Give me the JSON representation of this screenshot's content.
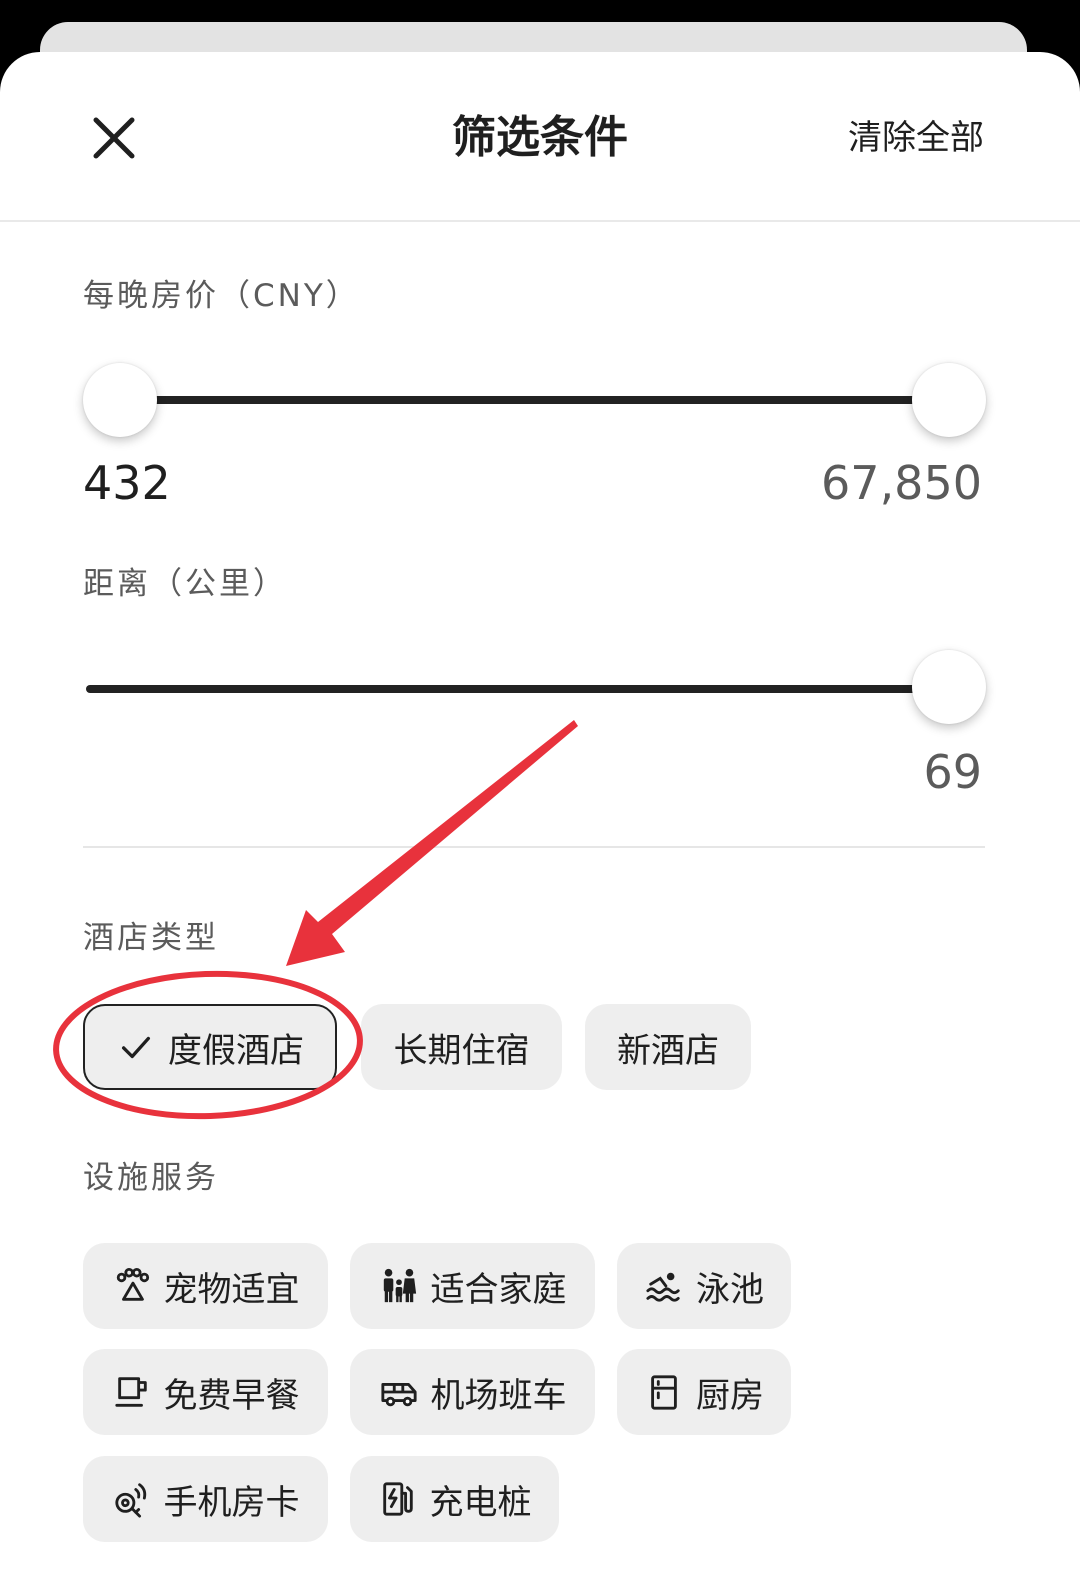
{
  "header": {
    "title": "筛选条件",
    "clear_label": "清除全部"
  },
  "price": {
    "label": "每晚房价（CNY）",
    "min_value": "432",
    "max_value": "67,850",
    "range_low_fraction": 0.0,
    "range_high_fraction": 1.0
  },
  "distance": {
    "label": "距离（公里）",
    "value": "69",
    "fraction": 1.0
  },
  "hotel_type": {
    "label": "酒店类型",
    "options": [
      {
        "label": "度假酒店",
        "selected": true
      },
      {
        "label": "长期住宿",
        "selected": false
      },
      {
        "label": "新酒店",
        "selected": false
      }
    ]
  },
  "amenities": {
    "label": "设施服务",
    "options": [
      {
        "label": "宠物适宜",
        "icon": "paw-icon"
      },
      {
        "label": "适合家庭",
        "icon": "family-icon"
      },
      {
        "label": "泳池",
        "icon": "pool-icon"
      },
      {
        "label": "免费早餐",
        "icon": "coffee-cup-icon"
      },
      {
        "label": "机场班车",
        "icon": "shuttle-bus-icon"
      },
      {
        "label": "厨房",
        "icon": "fridge-icon"
      },
      {
        "label": "手机房卡",
        "icon": "phone-key-icon"
      },
      {
        "label": "充电桩",
        "icon": "ev-charger-icon"
      }
    ]
  },
  "colors": {
    "annotation": "#e8323c",
    "track": "#222222",
    "chip_bg": "#eeeeee"
  }
}
